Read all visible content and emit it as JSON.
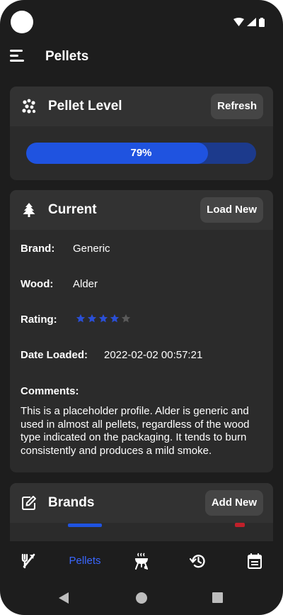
{
  "app": {
    "title": "Pellets"
  },
  "pellet_level": {
    "title": "Pellet Level",
    "refresh_label": "Refresh",
    "percent": 79,
    "percent_label": "79%"
  },
  "current": {
    "title": "Current",
    "load_new_label": "Load New",
    "brand_label": "Brand:",
    "brand_value": "Generic",
    "wood_label": "Wood:",
    "wood_value": "Alder",
    "rating_label": "Rating:",
    "rating_value": 4,
    "rating_max": 5,
    "date_label": "Date Loaded:",
    "date_value": "2022-02-02 00:57:21",
    "comments_label": "Comments:",
    "comments_value": "This is a placeholder profile.  Alder is generic and used in almost all pellets, regardless of the wood type indicated on the packaging.  It tends to burn consistently and produces a mild smoke."
  },
  "brands": {
    "title": "Brands",
    "add_new_label": "Add New"
  },
  "bottom_nav": {
    "items": [
      {
        "icon": "utensils-icon"
      },
      {
        "label": "Pellets",
        "active": true
      },
      {
        "icon": "grill-icon"
      },
      {
        "icon": "history-icon"
      },
      {
        "icon": "calendar-icon"
      }
    ]
  },
  "colors": {
    "background": "#1d1d1d",
    "card": "#2b2b2b",
    "card_header": "#323232",
    "accent": "#1f53e0",
    "nav_active": "#3a67ff",
    "star_filled": "#2a4fd6",
    "star_empty": "#5a5a5a"
  }
}
